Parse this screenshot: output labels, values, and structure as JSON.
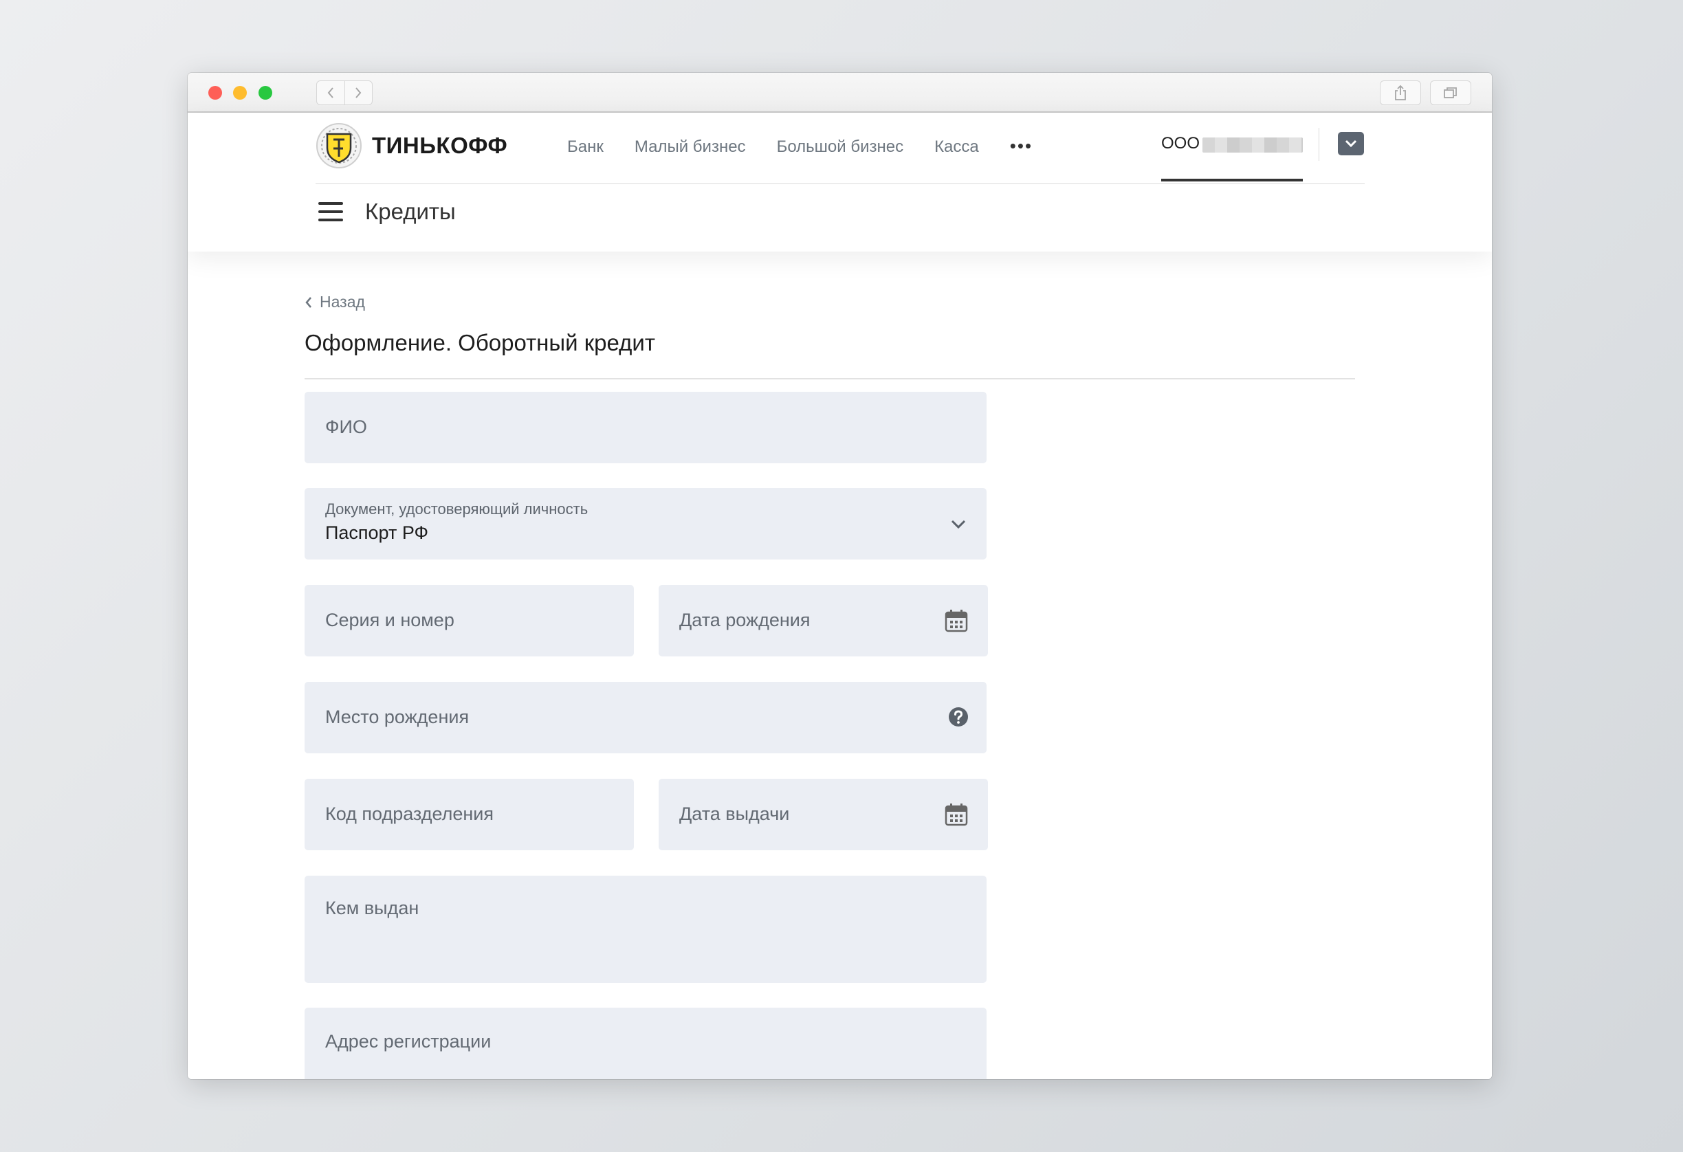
{
  "browser": {
    "colors": {
      "close": "#fe5f57",
      "minimize": "#febc2e",
      "maximize": "#28c840"
    }
  },
  "header": {
    "logo_text": "ТИНЬКОФФ",
    "nav": [
      "Банк",
      "Малый бизнес",
      "Большой бизнес",
      "Касса"
    ],
    "more": "•••",
    "org_prefix": "ООО",
    "section_title": "Кредиты"
  },
  "page": {
    "back_label": "Назад",
    "title": "Оформление. Оборотный кредит"
  },
  "form": {
    "fio": {
      "label": "ФИО"
    },
    "document": {
      "label": "Документ, удостоверяющий личность",
      "value": "Паспорт РФ"
    },
    "series": {
      "label": "Серия и номер"
    },
    "birth_date": {
      "label": "Дата рождения"
    },
    "birth_place": {
      "label": "Место рождения"
    },
    "division_code": {
      "label": "Код подразделения"
    },
    "issue_date": {
      "label": "Дата выдачи"
    },
    "issued_by": {
      "label": "Кем выдан"
    },
    "address": {
      "label": "Адрес регистрации"
    }
  },
  "icons": [
    "chevron-left-icon",
    "chevron-right-icon",
    "share-icon",
    "tabs-icon",
    "menu-icon",
    "chevron-down-icon",
    "calendar-icon",
    "help-icon"
  ],
  "colors": {
    "field_bg": "#ebeef4",
    "account_button": "#5c6571",
    "logo_yellow": "#ffdd2d"
  }
}
